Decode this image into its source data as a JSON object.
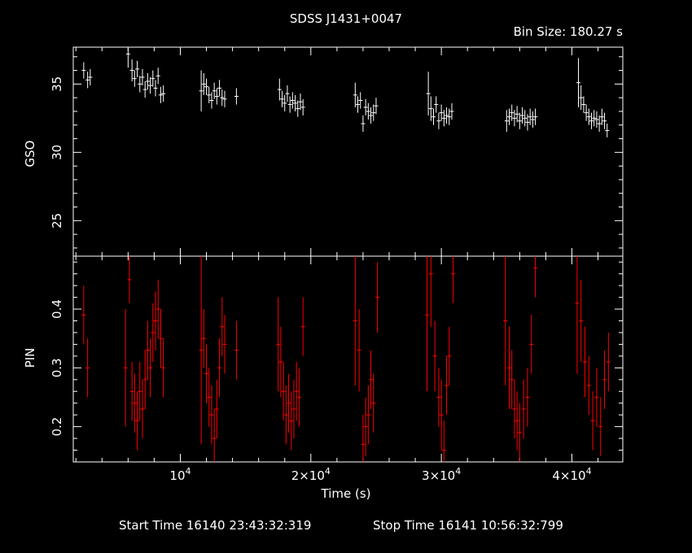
{
  "header": {
    "title": "SDSS J1431+0047",
    "bin_size": "Bin Size: 180.27 s"
  },
  "footer": {
    "start_time": "Start Time 16140 23:43:32:319",
    "stop_time": "Stop Time 16141 10:56:32:799"
  },
  "colors": {
    "background": "#000000",
    "gso": "#ffffff",
    "pin": "#ff0000"
  },
  "chart_data": [
    {
      "type": "scatter",
      "panel": "top",
      "ylabel": "GSO",
      "xlim": [
        1800,
        43900
      ],
      "ylim": [
        22.4,
        37.7
      ],
      "y_ticks": [
        25,
        30,
        35
      ],
      "y_tick_labels": [
        "25",
        "30",
        "35"
      ],
      "error_bars": true,
      "series": [
        {
          "x": [
            2600,
            2900,
            3100,
            6000,
            6300,
            6500,
            6700,
            6900,
            7100,
            7300,
            7500,
            7700,
            7900,
            8100,
            8300,
            8500,
            8700,
            11600,
            11800,
            12000,
            12200,
            12400,
            12600,
            12800,
            13000,
            13200,
            13400,
            14300,
            17600,
            17800,
            18000,
            18200,
            18400,
            18600,
            18800,
            19000,
            19200,
            19400,
            23400,
            23600,
            23800,
            24000,
            24200,
            24400,
            24600,
            24800,
            25000,
            29000,
            29200,
            29400,
            29600,
            29800,
            30000,
            30200,
            30400,
            30600,
            30800,
            35000,
            35200,
            35400,
            35600,
            35800,
            36000,
            36200,
            36400,
            36600,
            36800,
            37000,
            37200,
            40500,
            40700,
            40900,
            41100,
            41300,
            41500,
            41700,
            41900,
            42100,
            42300,
            42500,
            42700
          ],
          "y": [
            36.0,
            35.3,
            35.5,
            37.2,
            36.0,
            35.4,
            36.1,
            35.0,
            35.5,
            34.6,
            35.2,
            34.9,
            35.4,
            34.7,
            35.6,
            34.2,
            34.3,
            34.5,
            35.0,
            34.8,
            34.2,
            33.8,
            34.5,
            34.1,
            34.7,
            34.0,
            33.9,
            34.1,
            34.6,
            33.9,
            33.6,
            34.3,
            33.5,
            33.8,
            33.6,
            33.2,
            33.7,
            33.3,
            34.2,
            33.5,
            33.8,
            32.1,
            33.3,
            33.0,
            32.7,
            32.9,
            33.4,
            34.3,
            33.2,
            32.6,
            33.5,
            32.3,
            32.9,
            32.5,
            32.7,
            32.6,
            33.0,
            32.3,
            32.6,
            32.9,
            32.5,
            32.8,
            32.3,
            32.7,
            32.5,
            32.2,
            32.6,
            32.4,
            32.6,
            35.1,
            34.0,
            33.5,
            32.9,
            32.6,
            32.3,
            32.5,
            32.4,
            32.1,
            32.6,
            32.3,
            31.6
          ],
          "err": [
            0.6,
            0.6,
            0.6,
            1.0,
            0.8,
            0.6,
            0.6,
            0.6,
            0.6,
            0.6,
            0.6,
            0.6,
            0.6,
            0.6,
            0.6,
            0.6,
            0.6,
            1.5,
            0.8,
            0.6,
            0.6,
            0.6,
            0.6,
            0.6,
            0.6,
            0.6,
            0.6,
            0.6,
            0.8,
            0.6,
            0.6,
            0.6,
            0.6,
            0.6,
            0.6,
            0.6,
            0.6,
            0.6,
            0.9,
            0.6,
            0.6,
            0.6,
            0.6,
            0.6,
            0.6,
            0.6,
            0.6,
            1.6,
            0.9,
            0.6,
            0.6,
            0.6,
            0.6,
            0.6,
            0.6,
            0.6,
            0.6,
            0.8,
            0.6,
            0.6,
            0.6,
            0.6,
            0.6,
            0.6,
            0.6,
            0.6,
            0.6,
            0.6,
            0.6,
            1.8,
            0.9,
            0.6,
            0.6,
            0.6,
            0.6,
            0.6,
            0.6,
            0.6,
            0.6,
            0.6,
            0.5
          ]
        }
      ]
    },
    {
      "type": "scatter",
      "panel": "bottom",
      "xlabel": "Time (s)",
      "ylabel": "PIN",
      "xlim": [
        1800,
        43900
      ],
      "ylim": [
        0.14,
        0.49
      ],
      "x_ticks": [
        10000,
        20000,
        30000,
        40000
      ],
      "x_tick_labels": [
        "10",
        "2×10",
        "3×10",
        "4×10"
      ],
      "x_tick_exponent": "4",
      "y_ticks": [
        0.2,
        0.3,
        0.4
      ],
      "y_tick_labels": [
        "0.2",
        "0.3",
        "0.4"
      ],
      "error_bars": true,
      "series": [
        {
          "x": [
            2600,
            2900,
            5800,
            6100,
            6300,
            6500,
            6700,
            6900,
            7100,
            7300,
            7500,
            7700,
            7900,
            8100,
            8300,
            8500,
            8700,
            11600,
            11800,
            12000,
            12200,
            12400,
            12600,
            12800,
            13000,
            13200,
            13400,
            14300,
            17500,
            17700,
            17900,
            18100,
            18300,
            18500,
            18700,
            18900,
            19100,
            19400,
            23400,
            23700,
            24000,
            24200,
            24400,
            24600,
            24800,
            25100,
            28900,
            29200,
            29500,
            29800,
            30000,
            30200,
            30400,
            30600,
            30900,
            34900,
            35200,
            35400,
            35600,
            35800,
            36000,
            36300,
            36600,
            36900,
            37200,
            40400,
            40700,
            41000,
            41300,
            41600,
            41900,
            42200,
            42500,
            42800
          ],
          "y": [
            0.39,
            0.3,
            0.3,
            0.45,
            0.26,
            0.24,
            0.21,
            0.26,
            0.23,
            0.28,
            0.33,
            0.3,
            0.36,
            0.38,
            0.4,
            0.35,
            0.3,
            0.33,
            0.35,
            0.29,
            0.25,
            0.22,
            0.18,
            0.23,
            0.3,
            0.37,
            0.34,
            0.33,
            0.34,
            0.31,
            0.26,
            0.22,
            0.24,
            0.21,
            0.23,
            0.26,
            0.25,
            0.37,
            0.38,
            0.33,
            0.17,
            0.2,
            0.22,
            0.28,
            0.24,
            0.42,
            0.39,
            0.46,
            0.32,
            0.25,
            0.22,
            0.16,
            0.27,
            0.32,
            0.46,
            0.38,
            0.3,
            0.28,
            0.23,
            0.21,
            0.19,
            0.23,
            0.25,
            0.34,
            0.47,
            0.41,
            0.38,
            0.31,
            0.27,
            0.21,
            0.25,
            0.2,
            0.28,
            0.31
          ],
          "err": [
            0.05,
            0.05,
            0.1,
            0.04,
            0.05,
            0.05,
            0.05,
            0.05,
            0.05,
            0.05,
            0.05,
            0.05,
            0.05,
            0.05,
            0.05,
            0.05,
            0.05,
            0.16,
            0.05,
            0.05,
            0.05,
            0.05,
            0.05,
            0.05,
            0.05,
            0.05,
            0.05,
            0.05,
            0.08,
            0.06,
            0.05,
            0.05,
            0.05,
            0.05,
            0.05,
            0.05,
            0.05,
            0.05,
            0.11,
            0.07,
            0.05,
            0.05,
            0.05,
            0.05,
            0.05,
            0.06,
            0.13,
            0.09,
            0.06,
            0.05,
            0.06,
            0.05,
            0.05,
            0.05,
            0.05,
            0.11,
            0.07,
            0.05,
            0.05,
            0.05,
            0.05,
            0.05,
            0.05,
            0.05,
            0.05,
            0.12,
            0.07,
            0.06,
            0.05,
            0.05,
            0.05,
            0.05,
            0.05,
            0.05
          ]
        }
      ]
    }
  ]
}
